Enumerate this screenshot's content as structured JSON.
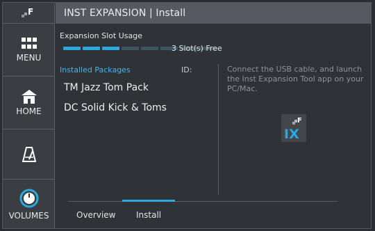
{
  "sidebar": {
    "logo_icon": "fantom-logo-icon",
    "items": [
      {
        "label": "MENU",
        "icon": "grid-icon"
      },
      {
        "label": "HOME",
        "icon": "home-icon"
      },
      {
        "label": "",
        "icon": "metronome-icon"
      },
      {
        "label": "VOLUMES",
        "icon": "volume-knob-icon"
      }
    ]
  },
  "header": {
    "title": "INST EXPANSION | Install"
  },
  "expansion": {
    "label": "Expansion Slot Usage",
    "slots_total": 8,
    "slots_used": 3,
    "free_text": "3 Slot(s) Free"
  },
  "packages": {
    "header": "Installed Packages",
    "id_header": "ID:",
    "items": [
      {
        "name": "TM Jazz Tom Pack"
      },
      {
        "name": "DC Solid Kick & Toms"
      }
    ]
  },
  "info": {
    "text": "Connect the USB cable, and launch the Inst Expansion Tool app on your PC/Mac.",
    "icon": "inst-expansion-tool-icon"
  },
  "tabs": [
    {
      "label": "Overview",
      "active": false
    },
    {
      "label": "Install",
      "active": true
    }
  ],
  "colors": {
    "accent": "#2aa9dd",
    "header_bg": "#565a60",
    "sidebar_bg": "#3a3d42",
    "panel_bg": "#2f3236"
  }
}
